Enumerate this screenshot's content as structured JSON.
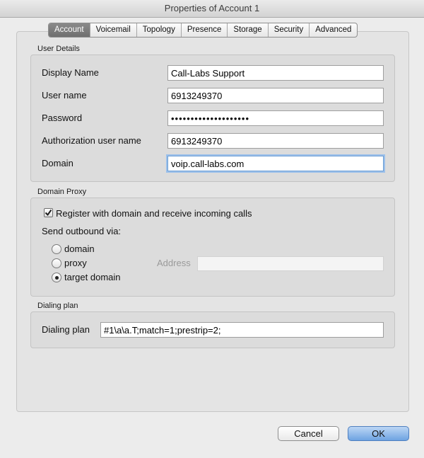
{
  "window": {
    "title": "Properties of Account 1"
  },
  "tabs": [
    {
      "label": "Account",
      "active": true
    },
    {
      "label": "Voicemail",
      "active": false
    },
    {
      "label": "Topology",
      "active": false
    },
    {
      "label": "Presence",
      "active": false
    },
    {
      "label": "Storage",
      "active": false
    },
    {
      "label": "Security",
      "active": false
    },
    {
      "label": "Advanced",
      "active": false
    }
  ],
  "user_details": {
    "title": "User Details",
    "display_name": {
      "label": "Display Name",
      "value": "Call-Labs Support"
    },
    "user_name": {
      "label": "User name",
      "value": "6913249370"
    },
    "password": {
      "label": "Password",
      "value": "••••••••••••••••••••"
    },
    "auth_user_name": {
      "label": "Authorization user name",
      "value": "6913249370"
    },
    "domain": {
      "label": "Domain",
      "value": "voip.call-labs.com"
    }
  },
  "domain_proxy": {
    "title": "Domain Proxy",
    "register_label": "Register with domain and receive incoming calls",
    "register_checked": true,
    "send_outbound_label": "Send outbound via:",
    "options": [
      {
        "label": "domain",
        "selected": false
      },
      {
        "label": "proxy",
        "selected": false
      },
      {
        "label": "target domain",
        "selected": true
      }
    ],
    "address_label": "Address",
    "address_value": ""
  },
  "dialing_plan": {
    "title": "Dialing plan",
    "label": "Dialing plan",
    "value": "#1\\a\\a.T;match=1;prestrip=2;"
  },
  "buttons": {
    "cancel": "Cancel",
    "ok": "OK"
  },
  "colors": {
    "accent": "#6ea3e2",
    "focus_ring": "#9cc0ea"
  }
}
